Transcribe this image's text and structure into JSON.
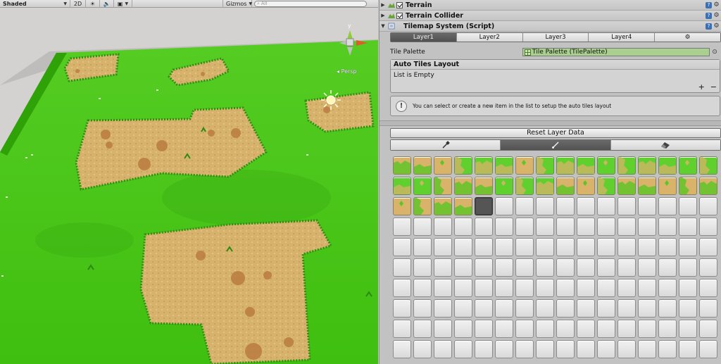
{
  "scene": {
    "shading_mode": "Shaded",
    "mode_2d": "2D",
    "gizmos_label": "Gizmos",
    "search_placeholder": "All",
    "persp_label": "Persp",
    "gizmo_axis_y": "y"
  },
  "inspector": {
    "components": [
      {
        "title": "Terrain"
      },
      {
        "title": "Terrain Collider"
      },
      {
        "title": "Tilemap System (Script)"
      }
    ],
    "layer_tabs": [
      "Layer1",
      "Layer2",
      "Layer3",
      "Layer4"
    ],
    "tile_palette_label": "Tile Palette",
    "tile_palette_value": "Tile Palette (TilePalette)",
    "auto_tiles": {
      "header": "Auto Tiles Layout",
      "empty_text": "List is Empty",
      "add_label": "+",
      "remove_label": "−",
      "help_text": "You can select or create a new item in the list to setup the auto tiles layout"
    },
    "reset_button_label": "Reset Layer Data",
    "tool_tabs": [
      "brush",
      "paint",
      "eraser"
    ],
    "tiles": {
      "columns": 16,
      "rows": 10,
      "row1": [
        "sand",
        "sand",
        "sand",
        "green",
        "green",
        "green",
        "sand",
        "green",
        "green",
        "green",
        "green",
        "green",
        "green",
        "green",
        "green",
        "green"
      ],
      "row2": [
        "green",
        "green",
        "sand",
        "sand",
        "sand",
        "green",
        "green",
        "green",
        "sand",
        "sand",
        "green",
        "sand",
        "sand",
        "sand",
        "sand",
        "sand"
      ],
      "row3": [
        "sand",
        "sand",
        "sand",
        "sand",
        "selected"
      ]
    }
  },
  "colors": {
    "grass": "#4fc71f",
    "sand": "#d9b36a",
    "panel_bg": "#c2c2c2",
    "active_tab": "#555555"
  }
}
